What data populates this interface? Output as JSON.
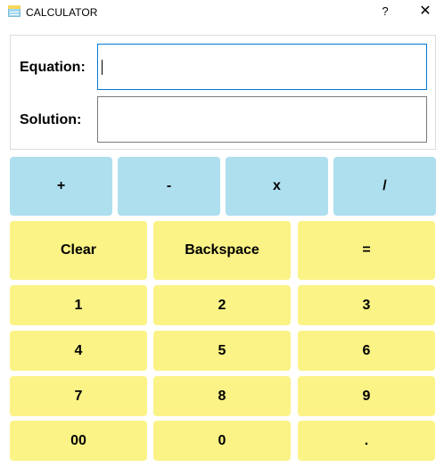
{
  "window": {
    "title": "CALCULATOR",
    "help_label": "?",
    "close_label": "✕",
    "app_icon": "calculator-app-icon"
  },
  "fields": {
    "equation_label": "Equation:",
    "equation_value": "",
    "solution_label": "Solution:",
    "solution_value": ""
  },
  "operators": {
    "add": "+",
    "subtract": "-",
    "multiply": "x",
    "divide": "/"
  },
  "controls": {
    "clear": "Clear",
    "backspace": "Backspace",
    "equals": "="
  },
  "digits": {
    "d1": "1",
    "d2": "2",
    "d3": "3",
    "d4": "4",
    "d5": "5",
    "d6": "6",
    "d7": "7",
    "d8": "8",
    "d9": "9",
    "d00": "00",
    "d0": "0",
    "dot": "."
  },
  "colors": {
    "operator_button": "#addfef",
    "digit_button": "#fbf386",
    "focused_field_border": "#0078d7"
  }
}
